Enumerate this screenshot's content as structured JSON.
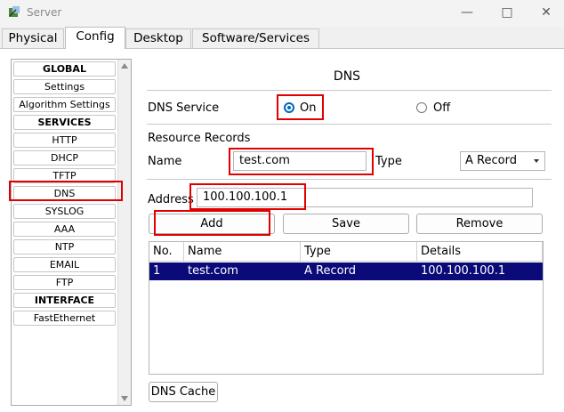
{
  "window": {
    "title": "Server"
  },
  "tabs": [
    "Physical",
    "Config",
    "Desktop",
    "Software/Services"
  ],
  "sidebar": {
    "items": [
      {
        "label": "GLOBAL",
        "header": true
      },
      {
        "label": "Settings"
      },
      {
        "label": "Algorithm Settings"
      },
      {
        "label": "SERVICES",
        "header": true
      },
      {
        "label": "HTTP"
      },
      {
        "label": "DHCP"
      },
      {
        "label": "TFTP"
      },
      {
        "label": "DNS",
        "selected": true
      },
      {
        "label": "SYSLOG"
      },
      {
        "label": "AAA"
      },
      {
        "label": "NTP"
      },
      {
        "label": "EMAIL"
      },
      {
        "label": "FTP"
      },
      {
        "label": "INTERFACE",
        "header": true
      },
      {
        "label": "FastEthernet"
      }
    ]
  },
  "dns": {
    "title": "DNS",
    "service_label": "DNS Service",
    "on_label": "On",
    "off_label": "Off",
    "service_state": "On",
    "resource_records_label": "Resource Records",
    "name_label": "Name",
    "name_value": "test.com",
    "type_label": "Type",
    "type_value": "A Record",
    "address_label": "Address",
    "address_value": "100.100.100.1",
    "add_label": "Add",
    "save_label": "Save",
    "remove_label": "Remove",
    "table": {
      "headers": [
        "No.",
        "Name",
        "Type",
        "Details"
      ],
      "rows": [
        {
          "no": "1",
          "name": "test.com",
          "type": "A Record",
          "details": "100.100.100.1"
        }
      ]
    },
    "cache_label": "DNS Cache"
  },
  "colors": {
    "highlight": "#e00000",
    "selected_row": "#0a0a78",
    "radio_accent": "#0067c0"
  }
}
